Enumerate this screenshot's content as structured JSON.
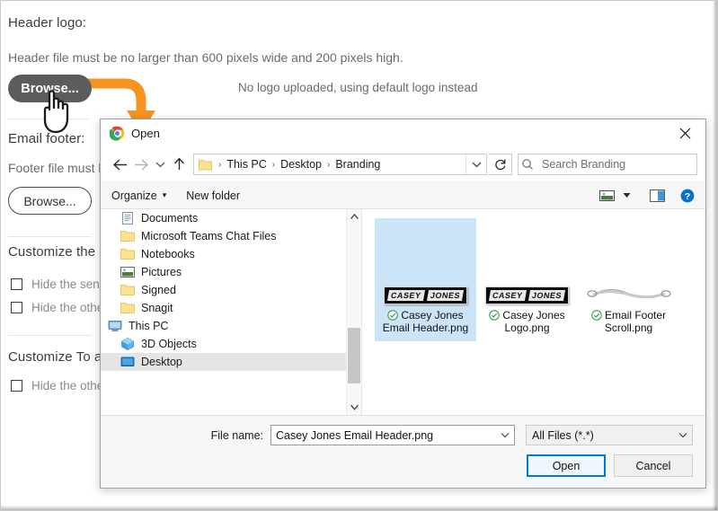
{
  "background": {
    "header_logo_label": "Header logo:",
    "header_note": "Header file must be no larger than 600 pixels wide and 200 pixels high.",
    "header_browse_label": "Browse...",
    "no_logo_text": "No logo uploaded, using default logo instead",
    "email_footer_label": "Email footer:",
    "footer_note": "Footer file must b",
    "footer_browse_label": "Browse...",
    "customize_section_1": "Customize the \"",
    "customize_section_2": "Customize To a",
    "checkbox_1": "Hide the sen",
    "checkbox_2": "Hide the othe",
    "checkbox_3": "Hide the othe"
  },
  "dialog": {
    "title": "Open",
    "close_label": "✕",
    "nav": {
      "back": "back-arrow",
      "forward": "forward-arrow",
      "recent": "recent-locations-chevron",
      "up": "up-arrow",
      "refresh": "refresh-icon"
    },
    "breadcrumbs": [
      "This PC",
      "Desktop",
      "Branding"
    ],
    "breadcrumb_separator": "›",
    "search_placeholder": "Search Branding",
    "commandbar": {
      "organize": "Organize",
      "organize_caret": "▾",
      "new_folder": "New folder",
      "view_icon": "view-mode-icon",
      "view_caret": "▾",
      "preview_icon": "preview-pane-icon",
      "help_icon": "help-icon"
    },
    "tree": [
      {
        "label": "Documents",
        "icon": "documents-icon",
        "indent": 2,
        "selected": false
      },
      {
        "label": "Microsoft Teams Chat Files",
        "icon": "folder-icon",
        "indent": 2,
        "selected": false
      },
      {
        "label": "Notebooks",
        "icon": "folder-icon",
        "indent": 2,
        "selected": false
      },
      {
        "label": "Pictures",
        "icon": "pictures-icon",
        "indent": 2,
        "selected": false
      },
      {
        "label": "Signed",
        "icon": "folder-icon",
        "indent": 2,
        "selected": false
      },
      {
        "label": "Snagit",
        "icon": "folder-icon",
        "indent": 2,
        "selected": false
      },
      {
        "label": "This PC",
        "icon": "this-pc-icon",
        "indent": 1,
        "selected": false
      },
      {
        "label": "3D Objects",
        "icon": "3d-objects-icon",
        "indent": 2,
        "selected": false
      },
      {
        "label": "Desktop",
        "icon": "desktop-icon",
        "indent": 2,
        "selected": true
      }
    ],
    "files": [
      {
        "name": "Casey Jones Email Header.png",
        "thumb": "casey-jones-logo",
        "words": [
          "CASEY",
          "JONES"
        ],
        "selected": true,
        "badge": "cloud-synced-check"
      },
      {
        "name": "Casey Jones Logo.png",
        "thumb": "casey-jones-logo",
        "words": [
          "CASEY",
          "JONES"
        ],
        "selected": false,
        "badge": "cloud-synced-check"
      },
      {
        "name": "Email Footer Scroll.png",
        "thumb": "scroll-graphic",
        "words": [],
        "selected": false,
        "badge": "cloud-synced-check"
      }
    ],
    "footer": {
      "file_name_label": "File name:",
      "file_name_value": "Casey Jones Email Header.png",
      "file_type_value": "All Files (*.*)",
      "open_label": "Open",
      "cancel_label": "Cancel"
    }
  },
  "annotation": {
    "arrow_color": "#F79421",
    "cursor": "hand-pointer-cursor"
  }
}
